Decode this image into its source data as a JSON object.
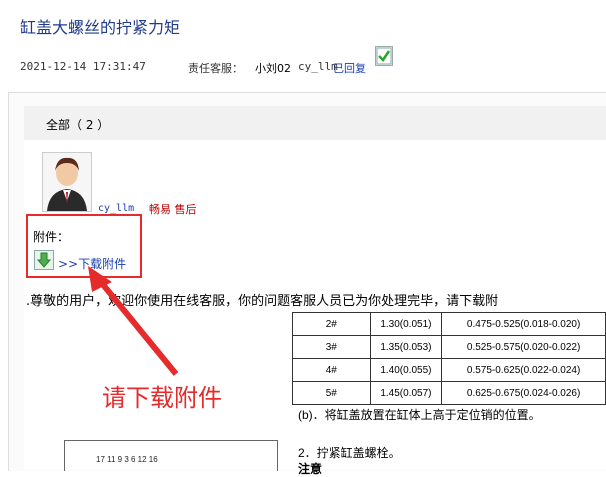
{
  "header": {
    "title": "缸盖大螺丝的拧紧力矩",
    "date": "2021-12-14 17:31:47",
    "service_label": "责任客服：",
    "service_name": "小刘02",
    "agent_id": "cy_llm",
    "status": "已回复"
  },
  "tabs": {
    "all_label": "全部（ 2 ）"
  },
  "reply": {
    "author_id": "cy_llm",
    "author_role": "畅易 售后",
    "attachment_label": "附件：",
    "download_link": ">>下载附件",
    "notice": ".尊敬的用户，欢迎你使用在线客服，你的问题客服人员已为你处理完毕，请下载附"
  },
  "annotation": {
    "text": "请下载附件",
    "color": "#e52b2b"
  },
  "doc_table": {
    "rows": [
      [
        "2#",
        "1.30(0.051)",
        "0.475-0.525(0.018-0.020)"
      ],
      [
        "3#",
        "1.35(0.053)",
        "0.525-0.575(0.020-0.022)"
      ],
      [
        "4#",
        "1.40(0.055)",
        "0.575-0.625(0.022-0.024)"
      ],
      [
        "5#",
        "1.45(0.057)",
        "0.625-0.675(0.024-0.026)"
      ]
    ]
  },
  "doc_notes": {
    "b": "(b)．将缸盖放置在缸体上高于定位销的位置。",
    "step2": "2．拧紧缸盖螺栓。",
    "caution": "注意"
  },
  "ruler": {
    "numbers": "17   11   9   3   6   12   16"
  },
  "icons": {
    "status_check": "check-icon",
    "download": "download-arrow-icon",
    "avatar": "user-avatar-icon"
  }
}
